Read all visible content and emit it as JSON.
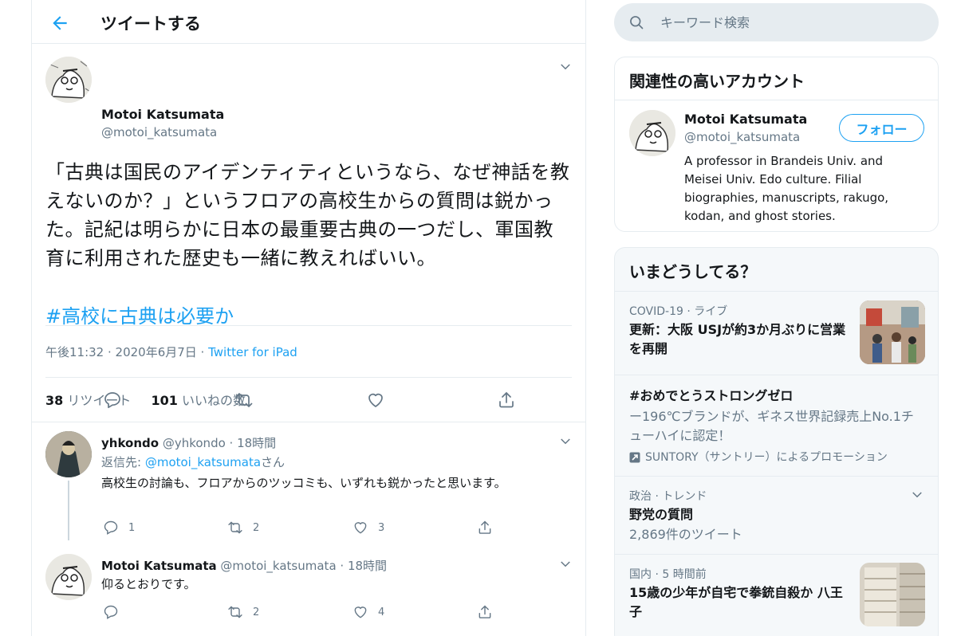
{
  "header": {
    "title": "ツイートする"
  },
  "tweet": {
    "name": "Motoi Katsumata",
    "handle": "@motoi_katsumata",
    "text": "「古典は国民のアイデンティティというなら、なぜ神話を教えないのか？」というフロアの高校生からの質問は鋭かった。記紀は明らかに日本の最重要古典の一つだし、軍国教育に利用された歴史も一緒に教えればいい。",
    "hashtag": "#高校に古典は必要か",
    "time": "午後11:32 · 2020年6月7日 · ",
    "source": "Twitter for iPad",
    "retweets_count": "38",
    "retweets_label": "リツイート",
    "likes_count": "101",
    "likes_label": "いいねの数"
  },
  "replies": [
    {
      "name": "yhkondo",
      "handle": "@yhkondo",
      "time": "· 18時間",
      "reply_to_prefix": "返信先: ",
      "reply_to_handle": "@motoi_katsumata",
      "reply_to_suffix": "さん",
      "text": "高校生の討論も、フロアからのツッコミも、いずれも鋭かったと思います。",
      "replies": "1",
      "retweets": "2",
      "likes": "3"
    },
    {
      "name": "Motoi Katsumata",
      "handle": "@motoi_katsumata",
      "time": "· 18時間",
      "text": "仰るとおりです。",
      "replies": "",
      "retweets": "2",
      "likes": "4"
    }
  ],
  "search": {
    "placeholder": "キーワード検索"
  },
  "relevant": {
    "title": "関連性の高いアカウント",
    "name": "Motoi Katsumata",
    "handle": "@motoi_katsumata",
    "follow_label": "フォロー",
    "bio": "A professor in Brandeis Univ. and Meisei Univ. Edo culture. Filial biographies, manuscripts, rakugo, kodan, and ghost stories."
  },
  "trends": {
    "title": "いまどうしてる？",
    "items": [
      {
        "category": "COVID-19 · ライブ",
        "title": "更新：大阪 USJが約3か月ぶりに営業を再開"
      },
      {
        "title": "#おめでとうストロングゼロ",
        "desc": "ー196℃ブランドが、ギネス世界記録売上No.1チューハイに認定！",
        "promo": "SUNTORY（サントリー）によるプロモーション"
      },
      {
        "category": "政治 · トレンド",
        "title": "野党の質問",
        "count": "2,869件のツイート"
      },
      {
        "category": "国内 · 5 時間前",
        "title": "15歳の少年が自宅で拳銃自殺か 八王子"
      }
    ]
  }
}
